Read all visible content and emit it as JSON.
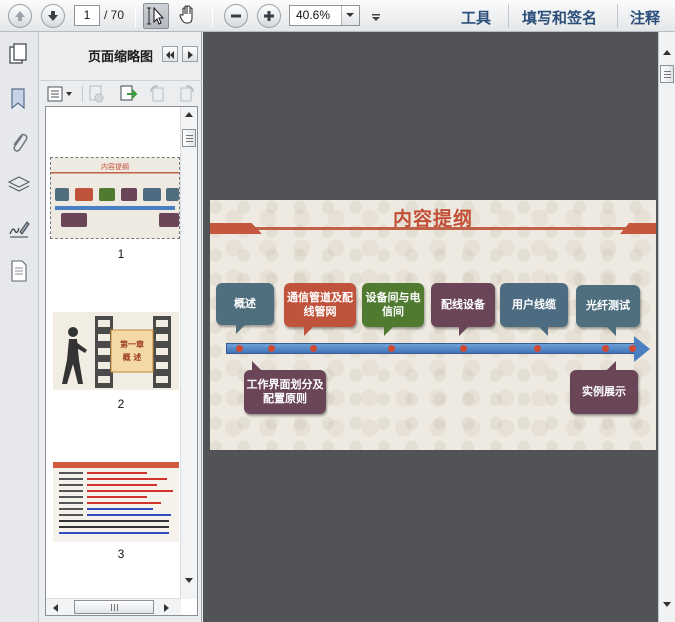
{
  "toolbar": {
    "page_current": "1",
    "page_total": "/ 70",
    "zoom_value": "40.6%",
    "tools_label": "工具",
    "sign_label": "填写和签名",
    "comment_label": "注释"
  },
  "thumbnails_panel": {
    "title": "页面缩略图",
    "pages": [
      {
        "number": "1"
      },
      {
        "number": "2"
      },
      {
        "number": "3"
      }
    ]
  },
  "slide": {
    "title": "内容提纲",
    "items_top": [
      {
        "label": "概述",
        "color": "#4f6f7f"
      },
      {
        "label": "通信管道及配线管网",
        "color": "#c0533b"
      },
      {
        "label": "设备间与电信间",
        "color": "#4f7a2f"
      },
      {
        "label": "配线设备",
        "color": "#6a4558"
      },
      {
        "label": "用户线缆",
        "color": "#4d6c82"
      },
      {
        "label": "光纤测试",
        "color": "#4f6f7f"
      }
    ],
    "items_bottom": [
      {
        "label": "工作界面划分及配置原则",
        "color": "#6a4558"
      },
      {
        "label": "实例展示",
        "color": "#6a4558"
      }
    ],
    "arrow_color": "#4a7fc1",
    "title_color": "#c34f36"
  }
}
